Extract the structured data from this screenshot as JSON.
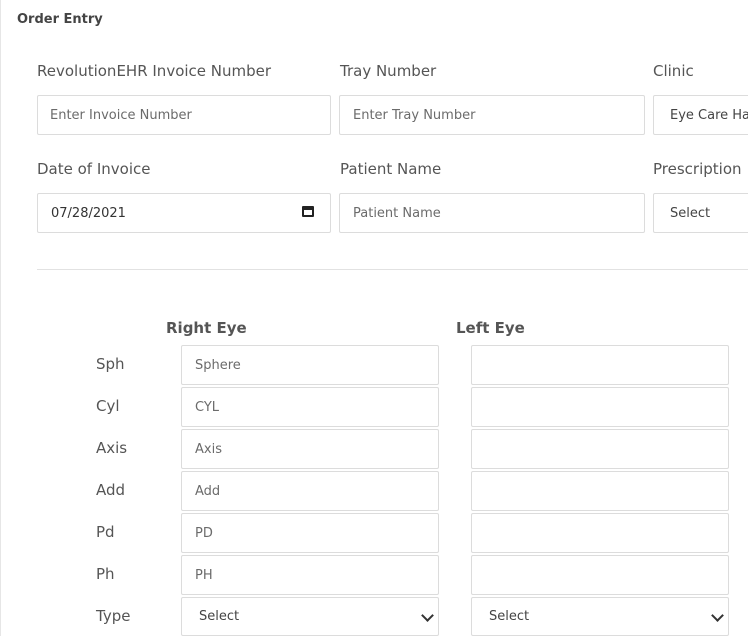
{
  "header": {
    "title": "Order Entry"
  },
  "form": {
    "invoice": {
      "label": "RevolutionEHR Invoice Number",
      "placeholder": "Enter Invoice Number"
    },
    "tray": {
      "label": "Tray Number",
      "placeholder": "Enter Tray Number"
    },
    "clinic": {
      "label": "Clinic",
      "value": "Eye Care Ha"
    },
    "date": {
      "label": "Date of Invoice",
      "value": "07/28/2021"
    },
    "patient": {
      "label": "Patient Name",
      "placeholder": "Patient Name"
    },
    "prescription": {
      "label": "Prescription",
      "value": "Select"
    }
  },
  "rx": {
    "right_header": "Right Eye",
    "left_header": "Left Eye",
    "rows": [
      {
        "label": "Sph",
        "right_placeholder": "Sphere",
        "left_placeholder": ""
      },
      {
        "label": "Cyl",
        "right_placeholder": "CYL",
        "left_placeholder": ""
      },
      {
        "label": "Axis",
        "right_placeholder": "Axis",
        "left_placeholder": ""
      },
      {
        "label": "Add",
        "right_placeholder": "Add",
        "left_placeholder": ""
      },
      {
        "label": "Pd",
        "right_placeholder": "PD",
        "left_placeholder": ""
      },
      {
        "label": "Ph",
        "right_placeholder": "PH",
        "left_placeholder": ""
      }
    ],
    "type": {
      "label": "Type",
      "right_value": "Select",
      "left_value": "Select"
    }
  },
  "icons": {
    "calendar": "calendar-icon",
    "select_arrow": "chevron-down-icon"
  }
}
